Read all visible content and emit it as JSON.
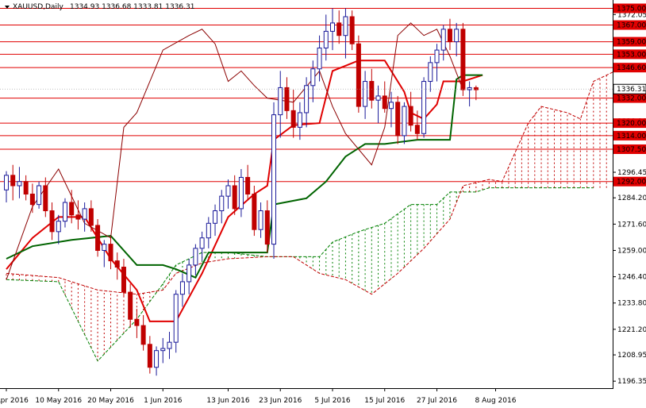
{
  "header": {
    "symbol": "XAUUSD,Daily",
    "ohlc": "1334.93 1336.68 1333.81 1336.31"
  },
  "chart_data": {
    "type": "candlestick",
    "title": "XAUUSD,Daily",
    "ylim": [
      1193,
      1379
    ],
    "y_ticks": [
      1372.05,
      1359.2,
      1346.35,
      1333.75,
      1320.9,
      1308.05,
      1296.45,
      1284.2,
      1271.6,
      1259.0,
      1246.4,
      1233.8,
      1221.2,
      1208.95,
      1196.35
    ],
    "x_ticks": [
      {
        "i": 0,
        "label": "28 Apr 2016"
      },
      {
        "i": 8,
        "label": "10 May 2016"
      },
      {
        "i": 16,
        "label": "20 May 2016"
      },
      {
        "i": 24,
        "label": "1 Jun 2016"
      },
      {
        "i": 34,
        "label": "13 Jun 2016"
      },
      {
        "i": 42,
        "label": "23 Jun 2016"
      },
      {
        "i": 50,
        "label": "5 Jul 2016"
      },
      {
        "i": 58,
        "label": "15 Jul 2016"
      },
      {
        "i": 66,
        "label": "27 Jul 2016"
      },
      {
        "i": 75,
        "label": "8 Aug 2016"
      }
    ],
    "levels": [
      1375.0,
      1367.0,
      1359.0,
      1353.0,
      1346.6,
      1332.0,
      1320.0,
      1314.0,
      1307.5,
      1292.0
    ],
    "current_price": 1336.31,
    "candles": [
      [
        1288,
        1297,
        1282,
        1295
      ],
      [
        1295,
        1300,
        1283,
        1290
      ],
      [
        1290,
        1299,
        1284,
        1292
      ],
      [
        1292,
        1295,
        1283,
        1286
      ],
      [
        1286,
        1291,
        1277,
        1281
      ],
      [
        1281,
        1292,
        1279,
        1290
      ],
      [
        1290,
        1294,
        1275,
        1278
      ],
      [
        1278,
        1282,
        1264,
        1268
      ],
      [
        1268,
        1276,
        1262,
        1273
      ],
      [
        1273,
        1284,
        1270,
        1282
      ],
      [
        1282,
        1288,
        1272,
        1276
      ],
      [
        1276,
        1283,
        1269,
        1274
      ],
      [
        1274,
        1282,
        1268,
        1279
      ],
      [
        1279,
        1283,
        1268,
        1271
      ],
      [
        1271,
        1274,
        1256,
        1259
      ],
      [
        1259,
        1264,
        1251,
        1262
      ],
      [
        1262,
        1265,
        1250,
        1254
      ],
      [
        1254,
        1258,
        1245,
        1251
      ],
      [
        1251,
        1255,
        1237,
        1239
      ],
      [
        1239,
        1243,
        1222,
        1226
      ],
      [
        1226,
        1231,
        1217,
        1223
      ],
      [
        1223,
        1228,
        1211,
        1214
      ],
      [
        1214,
        1218,
        1200,
        1203
      ],
      [
        1203,
        1213,
        1199,
        1211
      ],
      [
        1211,
        1217,
        1205,
        1212
      ],
      [
        1212,
        1220,
        1207,
        1215
      ],
      [
        1215,
        1240,
        1210,
        1238
      ],
      [
        1238,
        1248,
        1232,
        1244
      ],
      [
        1244,
        1255,
        1238,
        1252
      ],
      [
        1252,
        1262,
        1247,
        1260
      ],
      [
        1260,
        1268,
        1254,
        1265
      ],
      [
        1265,
        1275,
        1260,
        1272
      ],
      [
        1272,
        1281,
        1266,
        1278
      ],
      [
        1278,
        1288,
        1272,
        1285
      ],
      [
        1285,
        1293,
        1279,
        1290
      ],
      [
        1290,
        1295,
        1276,
        1279
      ],
      [
        1279,
        1298,
        1275,
        1294
      ],
      [
        1294,
        1300,
        1283,
        1286
      ],
      [
        1286,
        1290,
        1266,
        1269
      ],
      [
        1269,
        1282,
        1265,
        1278
      ],
      [
        1278,
        1283,
        1258,
        1262
      ],
      [
        1262,
        1330,
        1255,
        1324
      ],
      [
        1324,
        1345,
        1313,
        1337
      ],
      [
        1337,
        1342,
        1322,
        1326
      ],
      [
        1326,
        1336,
        1313,
        1318
      ],
      [
        1318,
        1330,
        1312,
        1325
      ],
      [
        1325,
        1342,
        1318,
        1338
      ],
      [
        1338,
        1350,
        1330,
        1346
      ],
      [
        1346,
        1362,
        1340,
        1356
      ],
      [
        1356,
        1372,
        1350,
        1364
      ],
      [
        1364,
        1375,
        1355,
        1368
      ],
      [
        1368,
        1374,
        1358,
        1362
      ],
      [
        1362,
        1375,
        1351,
        1371
      ],
      [
        1371,
        1374,
        1355,
        1358
      ],
      [
        1358,
        1362,
        1325,
        1328
      ],
      [
        1328,
        1345,
        1322,
        1340
      ],
      [
        1340,
        1346,
        1327,
        1331
      ],
      [
        1331,
        1338,
        1320,
        1333
      ],
      [
        1333,
        1340,
        1325,
        1327
      ],
      [
        1327,
        1335,
        1318,
        1330
      ],
      [
        1330,
        1333,
        1310,
        1314
      ],
      [
        1314,
        1330,
        1310,
        1328
      ],
      [
        1328,
        1335,
        1316,
        1319
      ],
      [
        1319,
        1326,
        1312,
        1315
      ],
      [
        1315,
        1342,
        1313,
        1340
      ],
      [
        1340,
        1352,
        1335,
        1349
      ],
      [
        1349,
        1358,
        1340,
        1355
      ],
      [
        1355,
        1367,
        1350,
        1365
      ],
      [
        1365,
        1370,
        1355,
        1359
      ],
      [
        1359,
        1368,
        1352,
        1365
      ],
      [
        1365,
        1368,
        1333,
        1336
      ],
      [
        1336,
        1340,
        1328,
        1337
      ],
      [
        1337,
        1338,
        1331,
        1336
      ]
    ],
    "candle_colors": {
      "bull": "#1a1a9a",
      "bear": "#c00000"
    },
    "indicators": [
      {
        "name": "tenkan",
        "color": "#e00000",
        "points": [
          [
            0,
            1250
          ],
          [
            4,
            1265
          ],
          [
            8,
            1275
          ],
          [
            12,
            1275
          ],
          [
            16,
            1255
          ],
          [
            20,
            1240
          ],
          [
            22,
            1225
          ],
          [
            26,
            1225
          ],
          [
            30,
            1248
          ],
          [
            34,
            1275
          ],
          [
            38,
            1286
          ],
          [
            40,
            1290
          ],
          [
            41,
            1312
          ],
          [
            44,
            1319
          ],
          [
            48,
            1320
          ],
          [
            50,
            1345
          ],
          [
            54,
            1350
          ],
          [
            58,
            1350
          ],
          [
            61,
            1335
          ],
          [
            62,
            1325
          ],
          [
            64,
            1322
          ],
          [
            66,
            1329
          ],
          [
            67,
            1340
          ],
          [
            70,
            1340
          ],
          [
            73,
            1343
          ]
        ]
      },
      {
        "name": "kijun",
        "color": "#006400",
        "points": [
          [
            0,
            1255
          ],
          [
            4,
            1261
          ],
          [
            10,
            1264
          ],
          [
            16,
            1266
          ],
          [
            20,
            1252
          ],
          [
            24,
            1252
          ],
          [
            26,
            1250
          ],
          [
            29,
            1246
          ],
          [
            31,
            1258
          ],
          [
            35,
            1258
          ],
          [
            40,
            1258
          ],
          [
            41,
            1281
          ],
          [
            46,
            1284
          ],
          [
            49,
            1292
          ],
          [
            52,
            1304
          ],
          [
            55,
            1310
          ],
          [
            58,
            1310
          ],
          [
            63,
            1312
          ],
          [
            68,
            1312
          ],
          [
            69,
            1341
          ],
          [
            70,
            1343
          ],
          [
            73,
            1343
          ]
        ]
      },
      {
        "name": "chikou",
        "color": "#8b0000",
        "points": [
          [
            0,
            1245
          ],
          [
            4,
            1280
          ],
          [
            8,
            1298
          ],
          [
            12,
            1272
          ],
          [
            16,
            1265
          ],
          [
            18,
            1318
          ],
          [
            20,
            1325
          ],
          [
            24,
            1355
          ],
          [
            28,
            1362
          ],
          [
            30,
            1365
          ],
          [
            32,
            1358
          ],
          [
            34,
            1340
          ],
          [
            36,
            1345
          ],
          [
            38,
            1338
          ],
          [
            40,
            1332
          ],
          [
            44,
            1330
          ],
          [
            48,
            1345
          ],
          [
            50,
            1328
          ],
          [
            52,
            1315
          ],
          [
            56,
            1300
          ],
          [
            58,
            1318
          ],
          [
            60,
            1362
          ],
          [
            62,
            1368
          ],
          [
            64,
            1362
          ],
          [
            66,
            1365
          ],
          [
            68,
            1352
          ],
          [
            70,
            1336
          ]
        ]
      }
    ],
    "cloud": {
      "senkou_a": {
        "color": "#008000",
        "points": [
          [
            0,
            1245
          ],
          [
            8,
            1244
          ],
          [
            14,
            1206
          ],
          [
            20,
            1226
          ],
          [
            24,
            1243
          ],
          [
            26,
            1252
          ],
          [
            30,
            1258
          ],
          [
            34,
            1258
          ],
          [
            40,
            1256
          ],
          [
            44,
            1256
          ],
          [
            48,
            1256
          ],
          [
            50,
            1263
          ],
          [
            54,
            1268
          ],
          [
            58,
            1272
          ],
          [
            62,
            1281
          ],
          [
            66,
            1281
          ],
          [
            68,
            1287
          ],
          [
            72,
            1287
          ],
          [
            74,
            1289
          ],
          [
            78,
            1289
          ],
          [
            82,
            1289
          ],
          [
            86,
            1289
          ],
          [
            90,
            1289
          ]
        ]
      },
      "senkou_b": {
        "color": "#c00000",
        "points": [
          [
            0,
            1248
          ],
          [
            8,
            1246
          ],
          [
            14,
            1240
          ],
          [
            20,
            1238
          ],
          [
            24,
            1240
          ],
          [
            26,
            1248
          ],
          [
            30,
            1253
          ],
          [
            34,
            1255
          ],
          [
            40,
            1256
          ],
          [
            44,
            1256
          ],
          [
            48,
            1248
          ],
          [
            52,
            1245
          ],
          [
            56,
            1238
          ],
          [
            60,
            1248
          ],
          [
            64,
            1260
          ],
          [
            68,
            1274
          ],
          [
            70,
            1290
          ],
          [
            74,
            1293
          ],
          [
            76,
            1292
          ],
          [
            80,
            1320
          ],
          [
            82,
            1328
          ],
          [
            86,
            1325
          ],
          [
            88,
            1322
          ],
          [
            90,
            1340
          ],
          [
            94,
            1346
          ]
        ]
      }
    }
  },
  "axis_labels_color": "#ffffff",
  "level_label_bg": "#e00000",
  "current_price_bg": "#ffffff"
}
